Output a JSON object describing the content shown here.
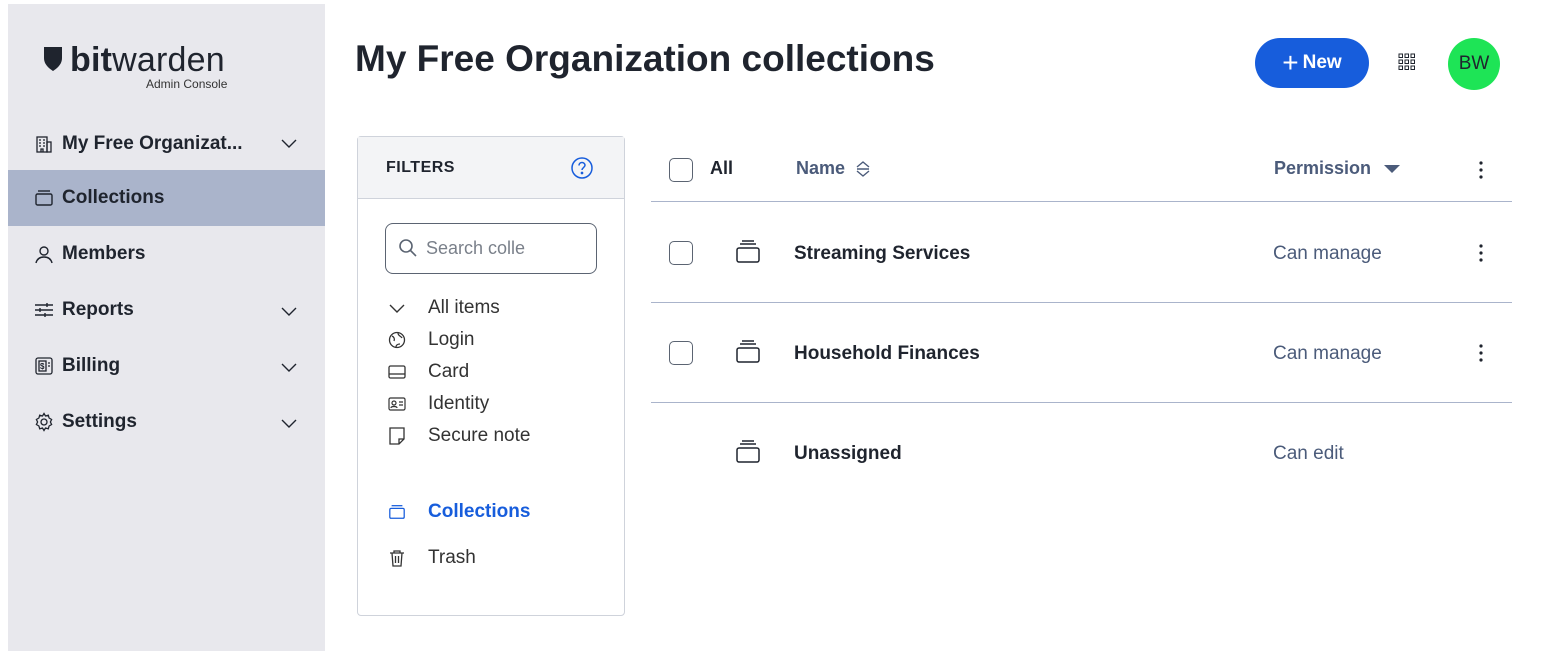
{
  "brand": {
    "name_bold": "bit",
    "name_light": "warden",
    "subtitle": "Admin Console"
  },
  "sidebar": {
    "items": [
      {
        "label": "My Free Organizat...",
        "icon": "building-icon",
        "expandable": true
      },
      {
        "label": "Collections",
        "icon": "collection-icon",
        "active": true
      },
      {
        "label": "Members",
        "icon": "user-icon"
      },
      {
        "label": "Reports",
        "icon": "sliders-icon",
        "expandable": true
      },
      {
        "label": "Billing",
        "icon": "billing-icon",
        "expandable": true
      },
      {
        "label": "Settings",
        "icon": "gear-icon",
        "expandable": true
      }
    ]
  },
  "header": {
    "title": "My Free Organization collections",
    "new_label": "New",
    "avatar_initials": "BW"
  },
  "filters": {
    "title": "FILTERS",
    "search_placeholder": "Search colle",
    "items": [
      {
        "label": "All items",
        "icon": "chevron-down-icon"
      },
      {
        "label": "Login",
        "icon": "globe-icon"
      },
      {
        "label": "Card",
        "icon": "card-icon"
      },
      {
        "label": "Identity",
        "icon": "id-card-icon"
      },
      {
        "label": "Secure note",
        "icon": "note-icon"
      },
      {
        "label": "Collections",
        "icon": "collection-icon",
        "active": true
      },
      {
        "label": "Trash",
        "icon": "trash-icon"
      }
    ]
  },
  "table": {
    "headers": {
      "all": "All",
      "name": "Name",
      "permission": "Permission"
    },
    "rows": [
      {
        "name": "Streaming Services",
        "permission": "Can manage"
      },
      {
        "name": "Household Finances",
        "permission": "Can manage"
      },
      {
        "name": "Unassigned",
        "permission": "Can edit"
      }
    ]
  },
  "colors": {
    "primary": "#175ddc",
    "sidebar_bg": "#e8e8ed",
    "sidebar_active": "#aab4cb",
    "avatar": "#1ee456"
  }
}
